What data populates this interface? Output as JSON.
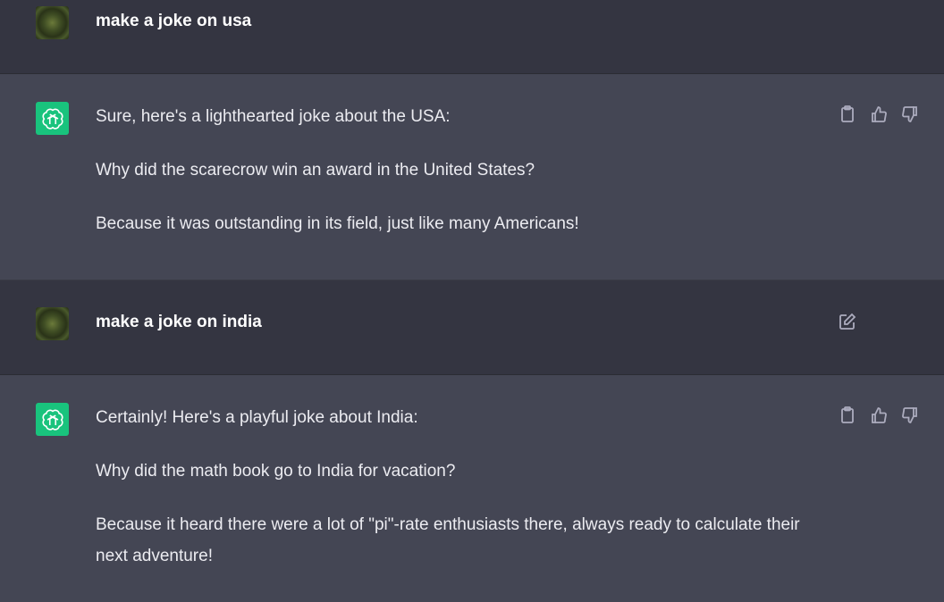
{
  "messages": [
    {
      "role": "user",
      "avatar_icon": "user-avatar-icon",
      "text": "make a joke on usa"
    },
    {
      "role": "assistant",
      "avatar_icon": "chatgpt-logo-icon",
      "paragraphs": [
        "Sure, here's a lighthearted joke about the USA:",
        "Why did the scarecrow win an award in the United States?",
        "Because it was outstanding in its field, just like many Americans!"
      ],
      "action_icons": [
        "clipboard-icon",
        "thumbs-up-icon",
        "thumbs-down-icon"
      ]
    },
    {
      "role": "user",
      "avatar_icon": "user-avatar-icon",
      "text": "make a joke on india",
      "action_icons": [
        "edit-icon"
      ]
    },
    {
      "role": "assistant",
      "avatar_icon": "chatgpt-logo-icon",
      "paragraphs": [
        "Certainly! Here's a playful joke about India:",
        "Why did the math book go to India for vacation?",
        "Because it heard there were a lot of \"pi\"-rate enthusiasts there, always ready to calculate their next adventure!"
      ],
      "action_icons": [
        "clipboard-icon",
        "thumbs-up-icon",
        "thumbs-down-icon"
      ]
    }
  ],
  "colors": {
    "user_bg": "#343541",
    "assistant_bg": "#444654",
    "gpt_logo_bg": "#19c37d",
    "text": "#ececf1",
    "icon": "#acacbe"
  }
}
